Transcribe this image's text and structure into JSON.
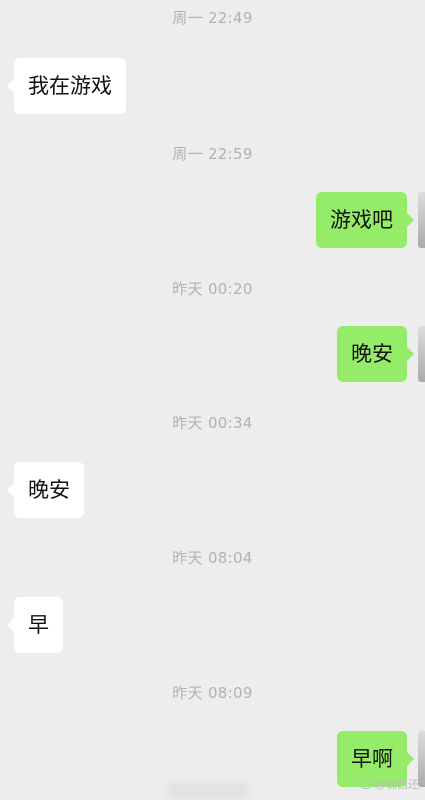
{
  "chat": {
    "messages": [
      {
        "type": "time",
        "text": "周一 22:49"
      },
      {
        "type": "received",
        "text": "我在游戏"
      },
      {
        "type": "time",
        "text": "周一 22:59"
      },
      {
        "type": "sent",
        "text": "游戏吧"
      },
      {
        "type": "time",
        "text": "昨天 00:20"
      },
      {
        "type": "sent",
        "text": "晚安"
      },
      {
        "type": "time",
        "text": "昨天 00:34"
      },
      {
        "type": "received",
        "text": "晚安"
      },
      {
        "type": "time",
        "text": "昨天 08:04"
      },
      {
        "type": "received",
        "text": "早"
      },
      {
        "type": "time",
        "text": "昨天 08:09"
      },
      {
        "type": "sent",
        "text": "早啊"
      }
    ]
  },
  "watermark": {
    "text": "@锦西还",
    "icon": "weibo-icon"
  },
  "colors": {
    "background": "#ededed",
    "sent_bubble": "#95ec69",
    "received_bubble": "#ffffff",
    "timestamp": "#b2b2b2"
  }
}
